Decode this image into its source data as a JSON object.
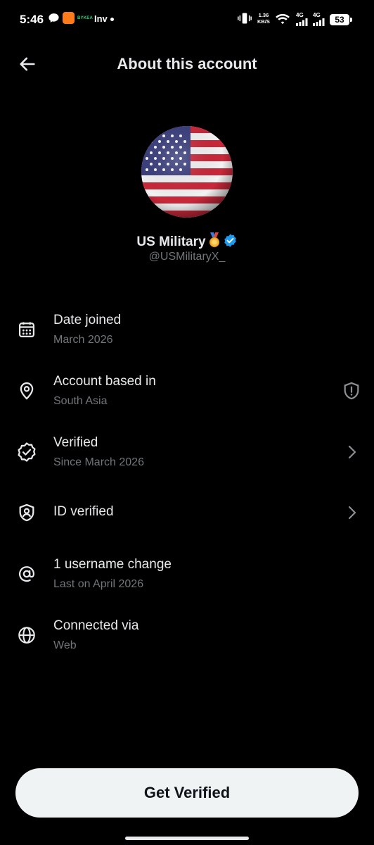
{
  "status_bar": {
    "time": "5:46",
    "brand": "BYKEA",
    "inv": "Inv",
    "net_speed_value": "1.36",
    "net_speed_unit": "KB/S",
    "sig1": "4G",
    "sig2": "4G",
    "battery": "53"
  },
  "header": {
    "title": "About this account"
  },
  "profile": {
    "name": "US Military",
    "handle": "@USMilitaryX_"
  },
  "info_items": [
    {
      "title": "Date joined",
      "subtitle": "March 2026"
    },
    {
      "title": "Account based in",
      "subtitle": "South Asia"
    },
    {
      "title": "Verified",
      "subtitle": "Since March 2026"
    },
    {
      "title": "ID verified",
      "subtitle": ""
    },
    {
      "title": "1 username change",
      "subtitle": "Last on April 2026"
    },
    {
      "title": "Connected via",
      "subtitle": "Web"
    }
  ],
  "cta": {
    "label": "Get Verified"
  },
  "colors": {
    "background": "#000000",
    "primary_text": "#e7e9ea",
    "secondary_text": "#71767b",
    "verified_badge": "#1d9bf0",
    "button_bg": "#eff3f4"
  }
}
